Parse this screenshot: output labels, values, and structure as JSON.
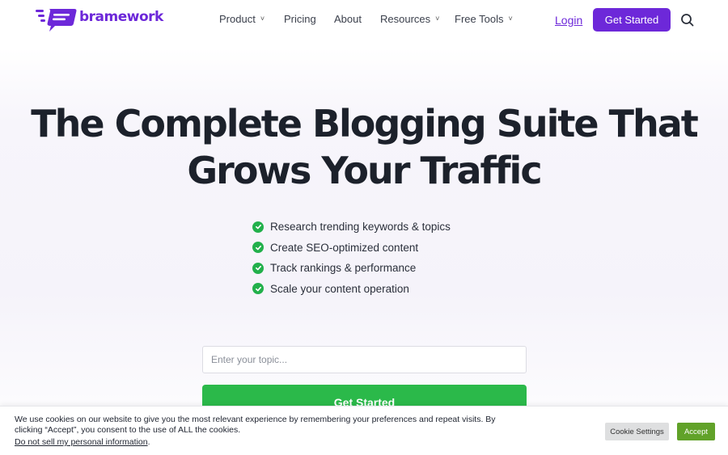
{
  "brand": {
    "name": "bramework",
    "color": "#6d28d9"
  },
  "nav": {
    "items": [
      {
        "label": "Product",
        "has_dropdown": true
      },
      {
        "label": "Pricing",
        "has_dropdown": false
      },
      {
        "label": "About",
        "has_dropdown": false
      },
      {
        "label": "Resources",
        "has_dropdown": true
      },
      {
        "label": "Free Tools",
        "has_dropdown": true
      }
    ],
    "login_label": "Login",
    "cta_label": "Get Started",
    "search_icon": "search-icon"
  },
  "hero": {
    "headline_line1": "The Complete Blogging Suite That",
    "headline_line2": "Grows Your Traffic",
    "features": [
      "Research trending keywords & topics",
      "Create SEO-optimized content",
      "Track rankings & performance",
      "Scale your content operation"
    ],
    "check_icon": "check-circle-icon",
    "check_color": "#22b04b",
    "topic_placeholder": "Enter your topic...",
    "topic_value": "",
    "cta_label": "Get Started",
    "cta_color": "#2bb94a"
  },
  "cookie_banner": {
    "text": "We use cookies on our website to give you the most relevant experience by remembering your preferences and repeat visits. By clicking “Accept”, you consent to the use of ALL the cookies.",
    "opt_out_link": "Do not sell my personal information",
    "opt_out_suffix": ".",
    "settings_label": "Cookie Settings",
    "accept_label": "Accept",
    "accept_color": "#61a229"
  }
}
